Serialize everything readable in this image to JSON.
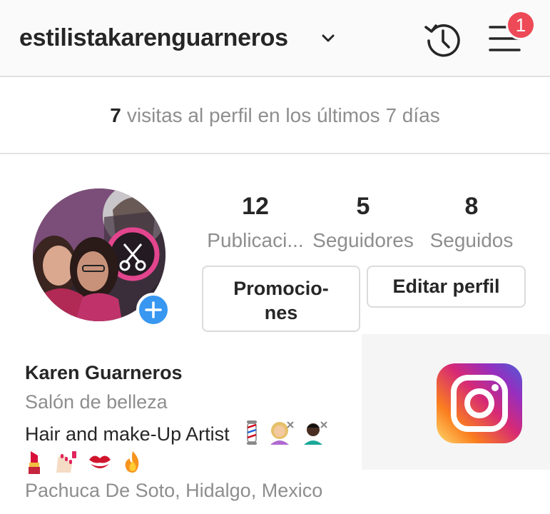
{
  "header": {
    "username": "estilistakarenguarneros",
    "notification_count": "1",
    "icons": [
      "chevron-down-icon",
      "history-icon",
      "hamburger-menu-icon"
    ]
  },
  "visits": {
    "count": "7",
    "text": "visitas al perfil en los últimos 7 días"
  },
  "stats": {
    "posts": {
      "value": "12",
      "label": "Publicaci..."
    },
    "followers": {
      "value": "5",
      "label": "Seguidores"
    },
    "following": {
      "value": "8",
      "label": "Seguidos"
    }
  },
  "buttons": {
    "promotions_line1": "Promocio-",
    "promotions_line2": "nes",
    "edit_profile": "Editar perfil"
  },
  "bio": {
    "name": "Karen Guarneros",
    "category": "Salón de belleza",
    "description": "Hair and make-Up Artist",
    "location": "Pachuca De Soto, Hidalgo, Mexico"
  },
  "colors": {
    "badge": "#ed4956",
    "add_button": "#3897f0",
    "secondary_text": "#8e8e8e"
  }
}
